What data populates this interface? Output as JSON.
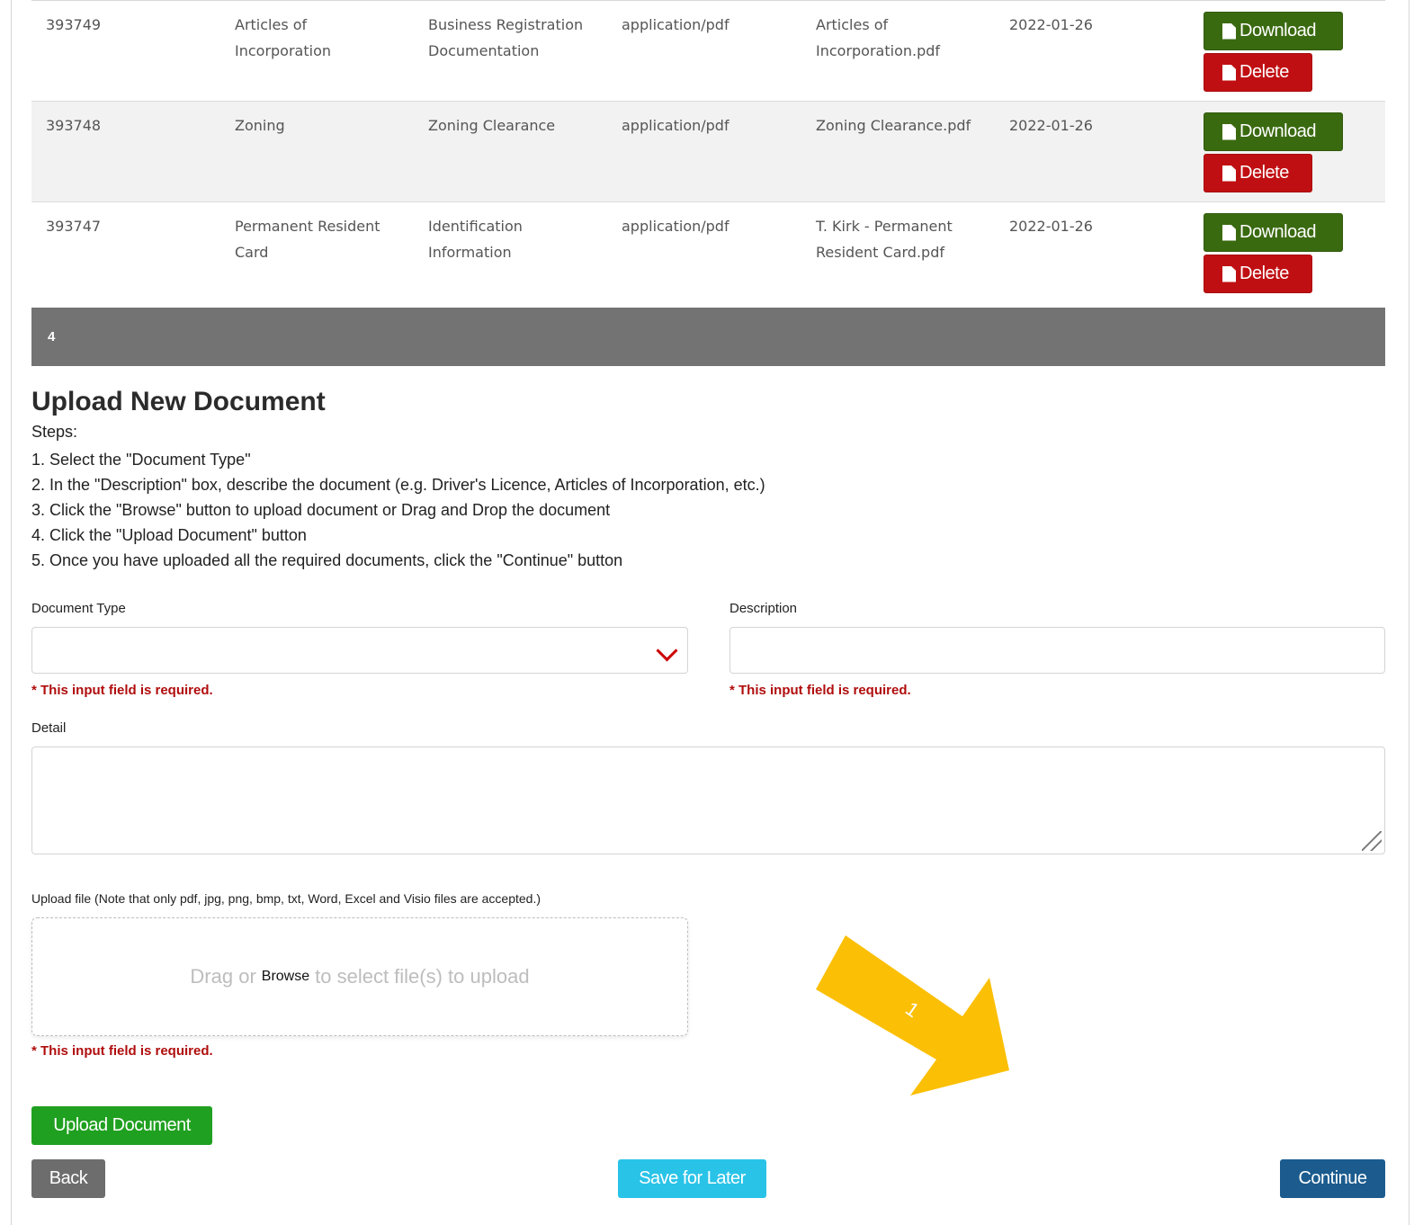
{
  "documents": [
    {
      "id": "393749",
      "name_l1": "Articles of",
      "name_l2": "Incorporation",
      "type_l1": "Business Registration",
      "type_l2": "Documentation",
      "mime": "application/pdf",
      "file_l1": "Articles of",
      "file_l2": "Incorporation.pdf",
      "date": "2022-01-26",
      "download": "Download",
      "delete": "Delete"
    },
    {
      "id": "393748",
      "name_l1": "Zoning",
      "name_l2": "",
      "type_l1": "Zoning Clearance",
      "type_l2": "",
      "mime": "application/pdf",
      "file_l1": "Zoning Clearance.pdf",
      "file_l2": "",
      "date": "2022-01-26",
      "download": "Download",
      "delete": "Delete"
    },
    {
      "id": "393747",
      "name_l1": "Permanent Resident",
      "name_l2": "Card",
      "type_l1": "Identification",
      "type_l2": "Information",
      "mime": "application/pdf",
      "file_l1": "T. Kirk - Permanent",
      "file_l2": "Resident Card.pdf",
      "date": "2022-01-26",
      "download": "Download",
      "delete": "Delete"
    }
  ],
  "step_bar": {
    "number": "4"
  },
  "upload": {
    "title": "Upload New Document",
    "steps_label": "Steps:",
    "steps": [
      "1. Select the \"Document Type\"",
      "2. In the \"Description\" box, describe the document (e.g. Driver's Licence, Articles of Incorporation, etc.)",
      "3. Click the \"Browse\" button to upload document or Drag and Drop the document",
      "4. Click the \"Upload Document\" button",
      "5. Once you have uploaded all the required documents, click the \"Continue\" button"
    ],
    "doc_type_label": "Document Type",
    "doc_type_value": "",
    "description_label": "Description",
    "description_value": "",
    "required_msg": "* This input field is required.",
    "detail_label": "Detail",
    "detail_value": "",
    "upload_file_label": "Upload file (Note that only pdf, jpg, png, bmp, txt, Word, Excel and Visio files are accepted.)",
    "drop_prefix": "Drag or",
    "drop_browse": "Browse",
    "drop_suffix": "to select file(s) to upload"
  },
  "buttons": {
    "upload_document": "Upload Document",
    "back": "Back",
    "save_for_later": "Save for Later",
    "continue": "Continue"
  },
  "annotation": {
    "label": "1",
    "color": "#fbbf05"
  },
  "colors": {
    "download": "#3a6a10",
    "delete": "#c00f12",
    "upload": "#20a020",
    "save": "#29c3e8",
    "continue": "#1b5b8e",
    "required": "#b00d0d"
  }
}
